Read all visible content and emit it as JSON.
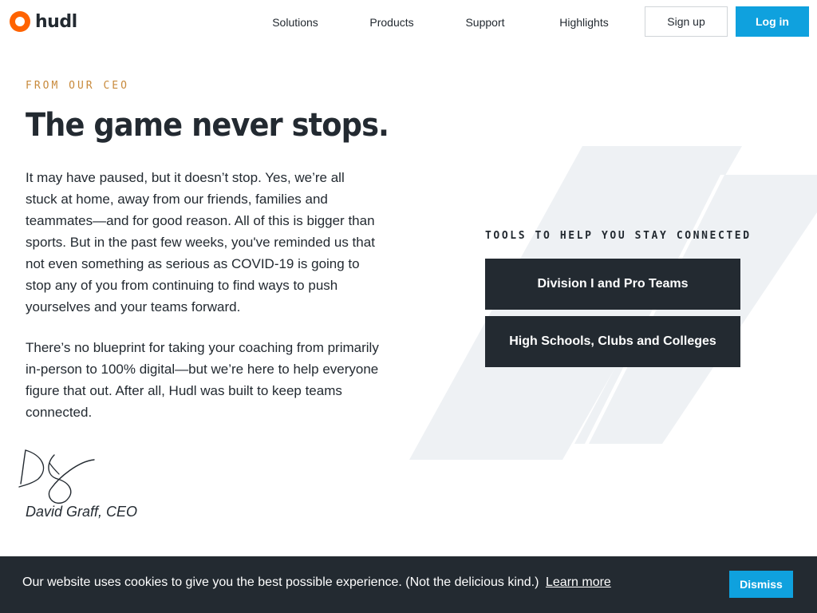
{
  "header": {
    "logo_text": "hudl",
    "nav": {
      "solutions": "Solutions",
      "products": "Products",
      "support": "Support",
      "highlights": "Highlights"
    },
    "signup_label": "Sign up",
    "login_label": "Log in"
  },
  "letter": {
    "eyebrow": "FROM OUR CEO",
    "headline": "The game never stops.",
    "paragraph_1": "It may have paused, but it doesn’t stop. Yes, we’re all stuck at home, away from our friends, families and teammates—and for good reason. All of this is bigger than sports. But in the past few weeks, you've reminded us that not even something as serious as COVID-19 is going to stop any of you from continuing to find ways to push yourselves and your teams forward.",
    "paragraph_2": "There’s no blueprint for taking your coaching from primarily in-person to 100% digital—but we’re here to help everyone figure that out. After all, Hudl was built to keep teams connected.",
    "signer": "David Graff, CEO"
  },
  "tools": {
    "heading": "TOOLS TO HELP YOU STAY CONNECTED",
    "cta_1": "Division I and Pro Teams",
    "cta_2": "High Schools, Clubs and Colleges"
  },
  "cookie_bar": {
    "message": "Our website uses cookies to give you the best possible experience. (Not the delicious kind.)",
    "link_label": "Learn more",
    "dismiss_label": "Dismiss"
  },
  "colors": {
    "accent_blue": "#0fa1de",
    "dark": "#232a31",
    "brand_orange": "#ff6300",
    "eyebrow": "#c88a3c",
    "panel_shape": "#eef1f4"
  },
  "icons": {
    "logo": "hudl-logo-icon",
    "signature": "signature-image"
  }
}
